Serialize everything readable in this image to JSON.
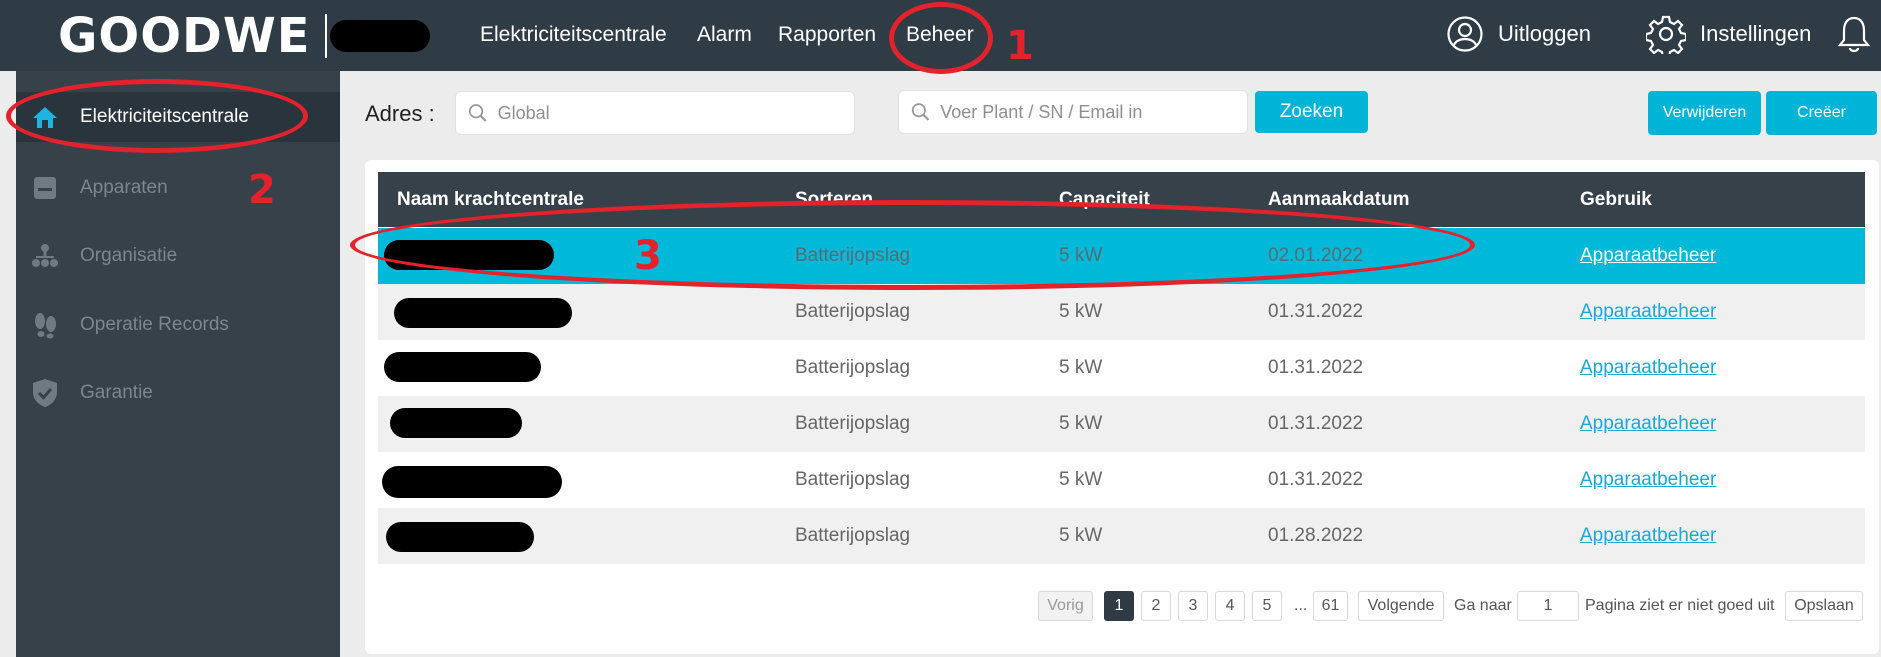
{
  "header": {
    "logo": "GOODWE",
    "nav": [
      "Elektriciteitscentrale",
      "Alarm",
      "Rapporten",
      "Beheer"
    ],
    "logout": "Uitloggen",
    "settings": "Instellingen",
    "icons": [
      "user-circle-icon",
      "gear-icon",
      "bell-icon"
    ]
  },
  "annotations": [
    "1",
    "2",
    "3"
  ],
  "sidebar": {
    "items": [
      {
        "label": "Elektriciteitscentrale",
        "icon": "home-icon",
        "active": true
      },
      {
        "label": "Apparaten",
        "icon": "device-icon",
        "active": false
      },
      {
        "label": "Organisatie",
        "icon": "org-tree-icon",
        "active": false
      },
      {
        "label": "Operatie Records",
        "icon": "footprints-icon",
        "active": false
      },
      {
        "label": "Garantie",
        "icon": "shield-check-icon",
        "active": false
      }
    ]
  },
  "toolbar": {
    "address_label": "Adres :",
    "address_placeholder": "Global",
    "search_placeholder": "Voer Plant / SN / Email in",
    "search_button": "Zoeken",
    "delete_button": "Verwijderen",
    "create_button": "Creëer"
  },
  "table": {
    "columns": [
      "Naam krachtcentrale",
      "Sorteren",
      "Capaciteit",
      "Aanmaakdatum",
      "Gebruik"
    ],
    "rows": [
      {
        "type": "Batterijopslag",
        "capacity": "5 kW",
        "date": "02.01.2022",
        "action": "Apparaatbeheer"
      },
      {
        "type": "Batterijopslag",
        "capacity": "5 kW",
        "date": "01.31.2022",
        "action": "Apparaatbeheer"
      },
      {
        "type": "Batterijopslag",
        "capacity": "5 kW",
        "date": "01.31.2022",
        "action": "Apparaatbeheer"
      },
      {
        "type": "Batterijopslag",
        "capacity": "5 kW",
        "date": "01.31.2022",
        "action": "Apparaatbeheer"
      },
      {
        "type": "Batterijopslag",
        "capacity": "5 kW",
        "date": "01.31.2022",
        "action": "Apparaatbeheer"
      },
      {
        "type": "Batterijopslag",
        "capacity": "5 kW",
        "date": "01.28.2022",
        "action": "Apparaatbeheer"
      }
    ]
  },
  "pagination": {
    "prev": "Vorig",
    "pages": [
      "1",
      "2",
      "3",
      "4",
      "5"
    ],
    "ellipsis": "...",
    "last": "61",
    "next": "Volgende",
    "goto_label": "Ga naar",
    "goto_value": "1",
    "page_label": "Pagina ziet er niet goed uit",
    "save": "Opslaan"
  },
  "colors": {
    "topbar": "#2f3b45",
    "sidebar": "#364149",
    "accent": "#00b4d8",
    "annotation": "#e3222b"
  }
}
